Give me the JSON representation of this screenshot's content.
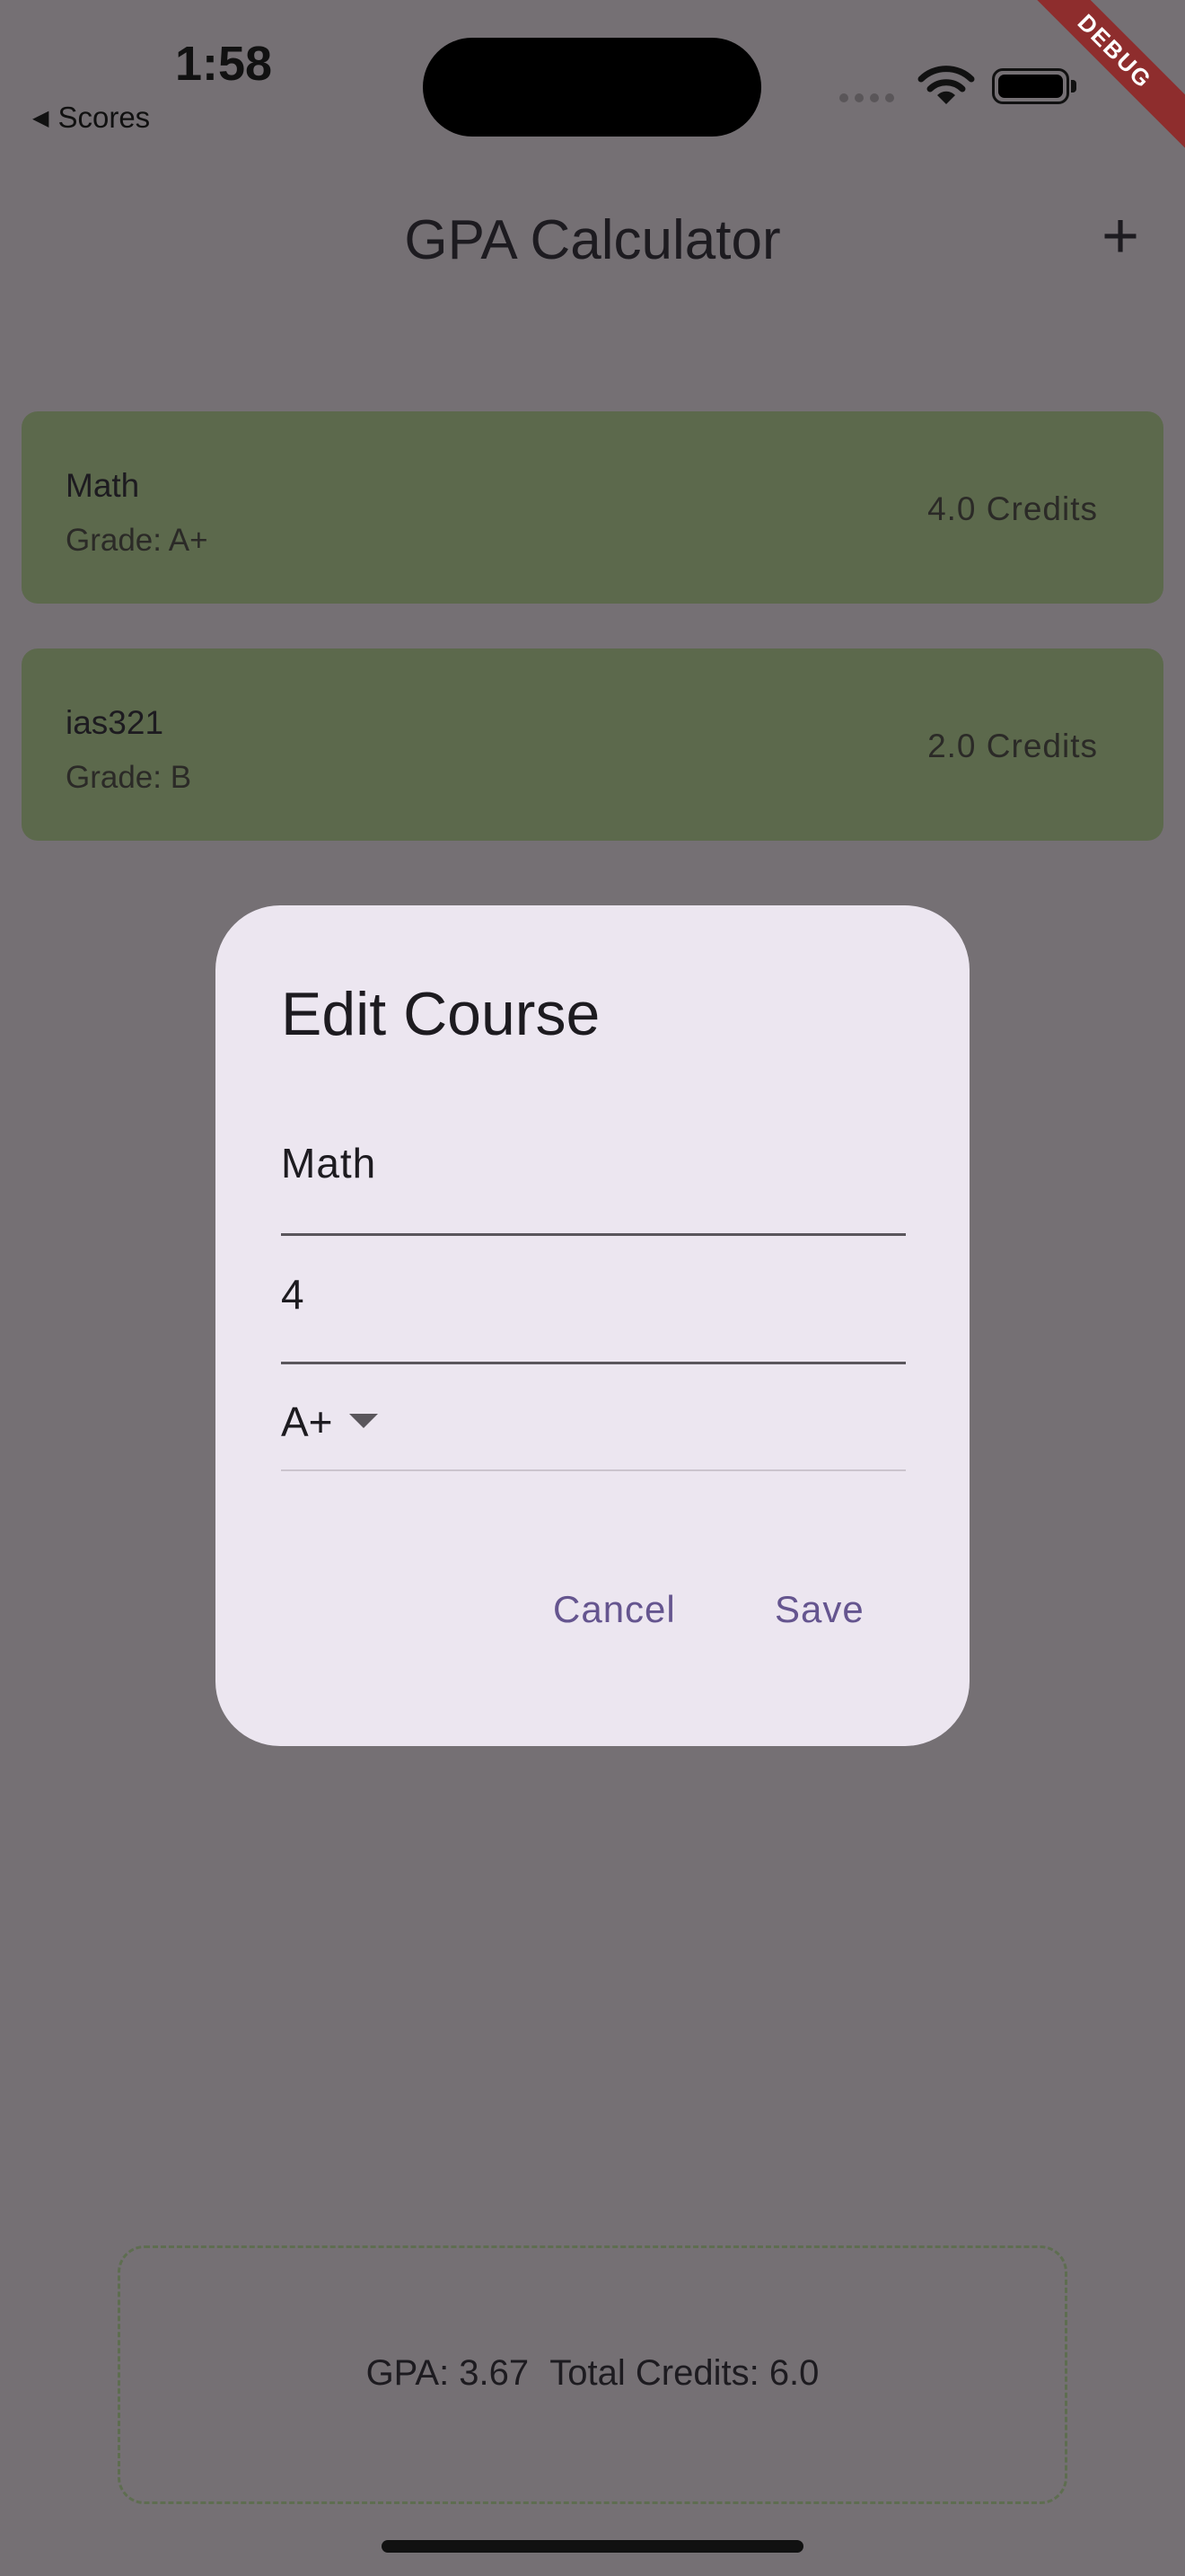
{
  "status_bar": {
    "time": "1:58",
    "back_label": "Scores"
  },
  "debug_banner": "DEBUG",
  "app_bar": {
    "title": "GPA Calculator",
    "add_icon": "+"
  },
  "courses": [
    {
      "name": "Math",
      "grade": "Grade: A+",
      "credits": "4.0 Credits"
    },
    {
      "name": "ias321",
      "grade": "Grade: B",
      "credits": "2.0 Credits"
    }
  ],
  "summary": {
    "gpa": "GPA: 3.67",
    "total_credits": "Total Credits: 6.0"
  },
  "dialog": {
    "title": "Edit Course",
    "name_value": "Math",
    "credits_value": "4",
    "grade_value": "A+",
    "cancel_label": "Cancel",
    "save_label": "Save"
  },
  "colors": {
    "scrim_background": "#757074",
    "card": "#5c694c",
    "dialog": "#ece6f0",
    "accent": "#65558f"
  },
  "icons": [
    "back-arrow-icon",
    "wifi-icon",
    "battery-icon",
    "add-icon",
    "dropdown-caret-icon"
  ]
}
